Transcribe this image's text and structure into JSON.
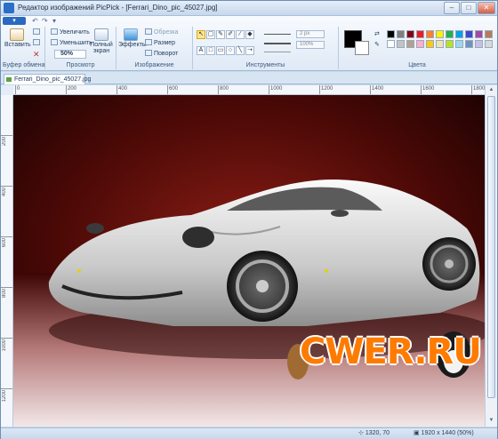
{
  "window": {
    "title": "Редактор изображений PicPick - [Ferrari_Dino_pic_45027.jpg]",
    "minimize": "–",
    "maximize": "□",
    "close": "✕"
  },
  "qat": {
    "file_button": "▾",
    "undo": "↶",
    "redo": "↷",
    "more": "▾"
  },
  "ribbon": {
    "clipboard": {
      "label": "Буфер обмена",
      "paste": "Вставить"
    },
    "view": {
      "label": "Просмотр",
      "zoom_in": "Увеличить",
      "zoom_out": "Уменьшить",
      "zoom_value": "50%",
      "fullscreen": "Полный экран"
    },
    "image": {
      "label": "Изображение",
      "effects": "Эффекты",
      "crop": "Обрезка",
      "resize": "Размер",
      "rotate": "Поворот"
    },
    "tools": {
      "label": "Инструменты",
      "text_tool": "A",
      "stroke_width": "2 px",
      "opacity": "100%"
    },
    "colors": {
      "label": "Цвета",
      "primary": "#000000",
      "secondary": "#ffffff",
      "palette": [
        "#000000",
        "#7f7f7f",
        "#880015",
        "#ed1c24",
        "#ff7f27",
        "#fff200",
        "#22b14c",
        "#00a2e8",
        "#3f48cc",
        "#a349a4",
        "#b97a57",
        "#ffffff",
        "#c3c3c3",
        "#b5a08a",
        "#ffaec9",
        "#ffc90e",
        "#efe4b0",
        "#b5e61d",
        "#99d9ea",
        "#7092be",
        "#c8bfe7",
        "#d8d8d8"
      ]
    }
  },
  "tab": {
    "label": "Ferrari_Dino_pic_45027.jpg"
  },
  "ruler": {
    "h": [
      "0",
      "200",
      "400",
      "600",
      "800",
      "1000",
      "1200",
      "1400",
      "1600",
      "1800"
    ],
    "v": [
      "200",
      "400",
      "600",
      "800",
      "1000",
      "1200"
    ]
  },
  "watermark": {
    "text": "CWER.RU"
  },
  "status": {
    "cursor": "1320, 70",
    "image_info": "1920 x 1440  (50%)"
  },
  "colors": {
    "accent": "#2a69c0",
    "ribbon": "#dfe9f5"
  }
}
